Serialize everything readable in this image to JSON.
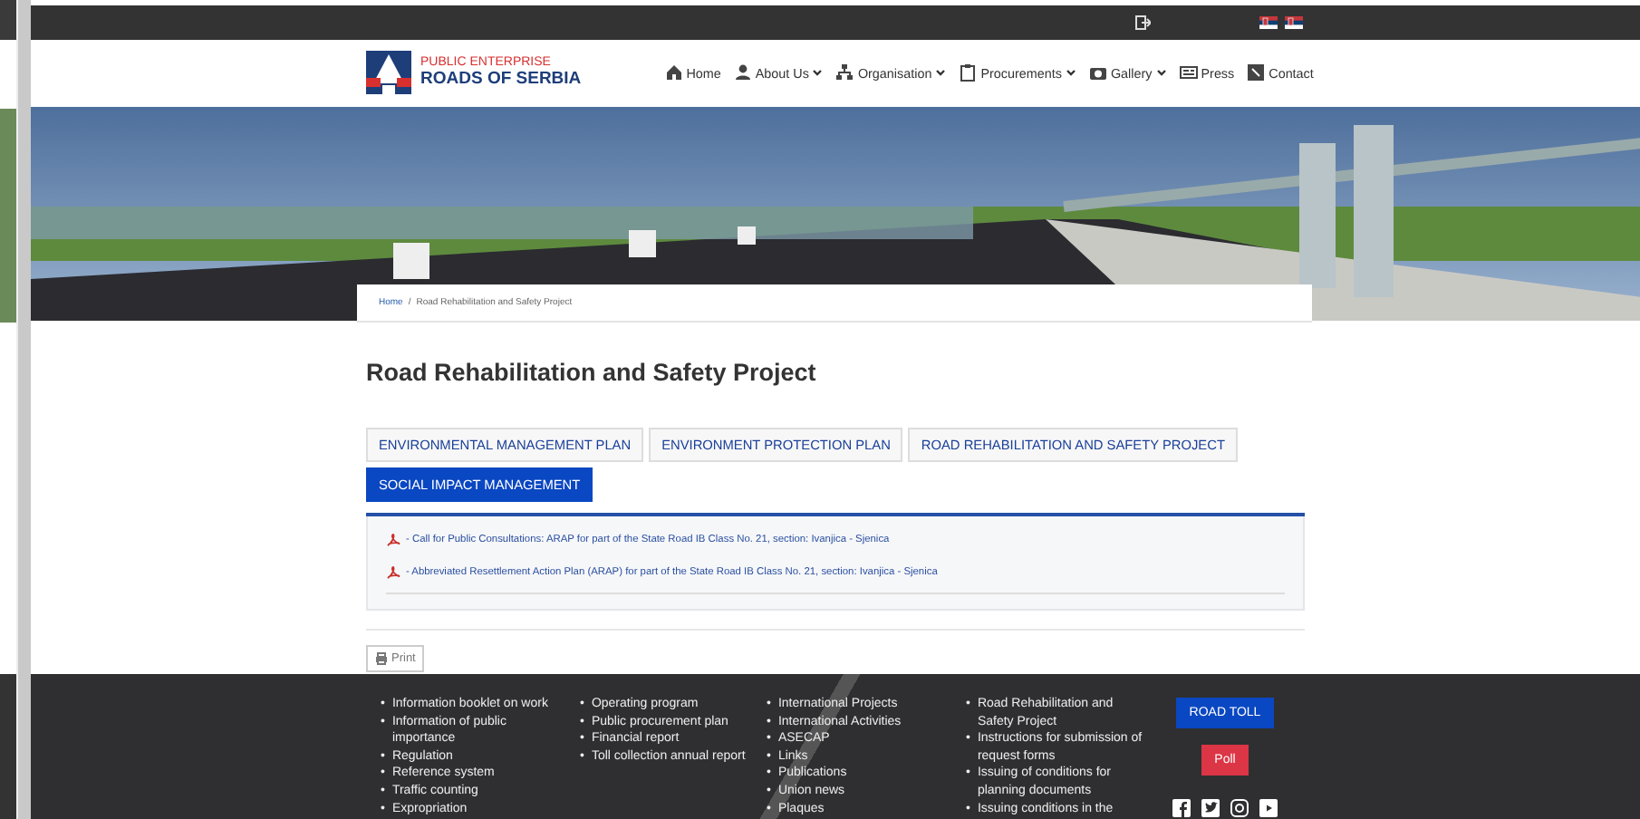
{
  "logo": {
    "line1": "PUBLIC ENTERPRISE",
    "line2": "ROADS OF SERBIA"
  },
  "nav": [
    {
      "label": "Home",
      "has_menu": false
    },
    {
      "label": "About Us",
      "has_menu": true
    },
    {
      "label": "Organisation",
      "has_menu": true
    },
    {
      "label": "Procurements",
      "has_menu": true
    },
    {
      "label": "Gallery",
      "has_menu": true
    },
    {
      "label": "Press",
      "has_menu": false
    },
    {
      "label": "Contact",
      "has_menu": false
    }
  ],
  "breadcrumb": {
    "separator": "/",
    "items": [
      "Home",
      "Road Rehabilitation and Safety Project"
    ]
  },
  "title": "Road Rehabilitation and Safety Project",
  "tabs": [
    {
      "label": "ENVIRONMENTAL MANAGEMENT PLAN",
      "selected": false
    },
    {
      "label": "ENVIRONMENT PROTECTION PLAN",
      "selected": false
    },
    {
      "label": "ROAD REHABILITATION AND SAFETY PROJECT",
      "selected": false
    },
    {
      "label": "SOCIAL IMPACT MANAGEMENT",
      "selected": true
    }
  ],
  "documents": [
    "- Call for Public Consultations: ARAP for part of the State Road IB Class No. 21, section: Ivanjica - Sjenica",
    "- Abbreviated Resettlement Action Plan (ARAP) for part of the State Road IB Class No. 21, section: Ivanjica - Sjenica"
  ],
  "print_button": "Print",
  "footer": {
    "bullet": "•",
    "columns": [
      [
        "Information booklet on work",
        "Information of public importance",
        "Regulation",
        "Reference system",
        "Traffic counting",
        "Expropriation"
      ],
      [
        "Operating program",
        "Public procurement plan",
        "Financial report",
        "Toll collection annual report"
      ],
      [
        "International Projects",
        "International Activities",
        "ASECAP",
        "Links",
        "Publications",
        "Union news",
        "Plaques"
      ],
      [
        "Road Rehabilitation and Safety Project",
        "Instructions for submission of request forms",
        "Issuing of conditions for planning documents",
        "Issuing conditions in the"
      ]
    ],
    "buttons": [
      {
        "label": "ROAD TOLL",
        "kind": "primary"
      },
      {
        "label": "Poll",
        "kind": "danger"
      }
    ]
  }
}
